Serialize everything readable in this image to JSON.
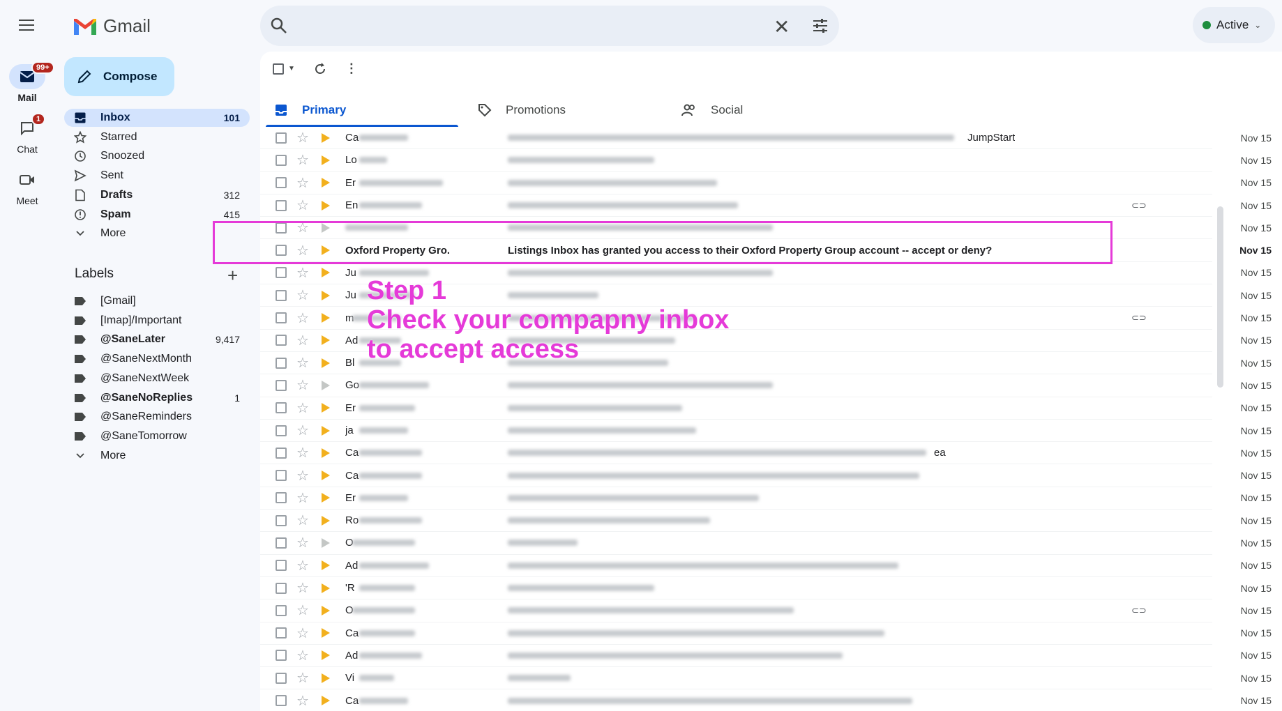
{
  "rail": {
    "mail": {
      "label": "Mail",
      "badge": "99+"
    },
    "chat": {
      "label": "Chat",
      "badge": "1"
    },
    "meet": {
      "label": "Meet"
    }
  },
  "brand": {
    "name": "Gmail"
  },
  "compose_label": "Compose",
  "nav": [
    {
      "label": "Inbox",
      "count": "101",
      "icon": "inbox-icon",
      "active": true,
      "bold": true
    },
    {
      "label": "Starred",
      "count": "",
      "icon": "star-icon"
    },
    {
      "label": "Snoozed",
      "count": "",
      "icon": "clock-icon"
    },
    {
      "label": "Sent",
      "count": "",
      "icon": "send-icon"
    },
    {
      "label": "Drafts",
      "count": "312",
      "icon": "file-icon",
      "bold": true
    },
    {
      "label": "Spam",
      "count": "415",
      "icon": "alert-icon",
      "bold": true
    },
    {
      "label": "More",
      "count": "",
      "icon": "chevron-down-icon"
    }
  ],
  "labels_heading": "Labels",
  "labels": [
    {
      "label": "[Gmail]",
      "count": ""
    },
    {
      "label": "[Imap]/Important",
      "count": ""
    },
    {
      "label": "@SaneLater",
      "count": "9,417",
      "bold": true
    },
    {
      "label": "@SaneNextMonth",
      "count": ""
    },
    {
      "label": "@SaneNextWeek",
      "count": ""
    },
    {
      "label": "@SaneNoReplies",
      "count": "1",
      "bold": true
    },
    {
      "label": "@SaneReminders",
      "count": ""
    },
    {
      "label": "@SaneTomorrow",
      "count": ""
    }
  ],
  "labels_more": "More",
  "status_label": "Active",
  "tabs": [
    {
      "label": "Primary",
      "icon": "inbox-tab-icon"
    },
    {
      "label": "Promotions",
      "icon": "tag-icon"
    },
    {
      "label": "Social",
      "icon": "people-icon"
    }
  ],
  "highlighted_email": {
    "sender": "Oxford Property Gro.",
    "subject": "Listings Inbox has granted you access to their Oxford Property Group account -- accept or deny?",
    "date": "Nov 15"
  },
  "row_fragments": {
    "first_subject_tail": "JumpStart",
    "senders": [
      "Ca",
      "Lo",
      "Er",
      "En",
      "",
      "",
      "Ju",
      "Ju",
      "m",
      "Ad",
      "Bl",
      "Go",
      "Er",
      "ja",
      "Ca",
      "Ca",
      "Er",
      "Ro",
      "O",
      "Ad",
      "'R",
      "O",
      "Ca",
      "Ad",
      "Vi",
      "Ca"
    ],
    "tail_text": "ea"
  },
  "date_label": "Nov 15",
  "overlay": {
    "line1": "Step 1",
    "line2": "Check your compapny inbox",
    "line3": "to accept access"
  },
  "colors": {
    "accent": "#0b57d0",
    "highlight": "#e53ad8",
    "compose": "#c2e7ff",
    "important": "#f2b01e"
  }
}
